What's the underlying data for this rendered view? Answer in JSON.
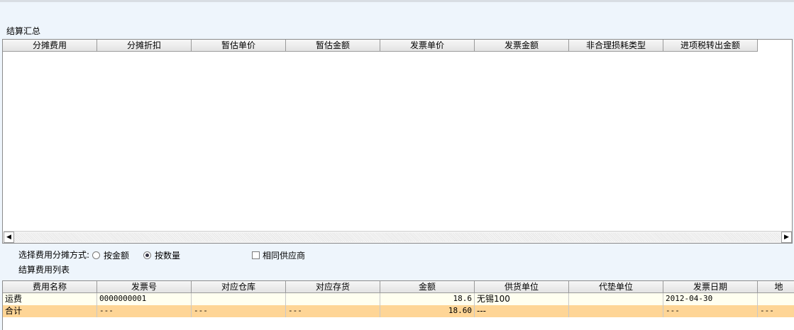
{
  "summary": {
    "title": "结算汇总",
    "columns": [
      "分摊费用",
      "分摊折扣",
      "暂估单价",
      "暂估金额",
      "发票单价",
      "发票金额",
      "非合理损耗类型",
      "进项税转出金额"
    ]
  },
  "allocation": {
    "label": "选择费用分摊方式:",
    "options": [
      "按金额",
      "按数量"
    ],
    "selected": "按数量",
    "same_supplier_label": "相同供应商",
    "same_supplier_checked": false
  },
  "fee_list": {
    "title": "结算费用列表",
    "columns": [
      "费用名称",
      "发票号",
      "对应仓库",
      "对应存货",
      "金额",
      "供货单位",
      "代垫单位",
      "发票日期",
      "地"
    ],
    "rows": [
      [
        "运费",
        "0000000001",
        "",
        "",
        "18.6",
        "无锡100",
        "",
        "2012-04-30",
        ""
      ]
    ],
    "total_row": [
      "合计",
      "---",
      "---",
      "---",
      "18.60",
      "---",
      "",
      "---",
      "---"
    ]
  },
  "colors": {
    "background": "#eef5fc",
    "total_row": "#fed596",
    "data_row": "#fffff0",
    "selected_cell": "#fffff0"
  }
}
